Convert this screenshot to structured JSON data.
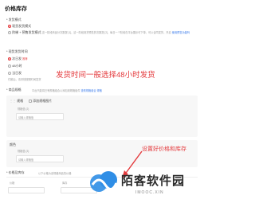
{
  "page": {
    "title": "价格库存"
  },
  "payment": {
    "section_label": "* 发货模式",
    "options": [
      {
        "label": "现货发货模式",
        "checked": true
      },
      {
        "label": "阶梯 + 预售发货模式",
        "checked": false
      }
    ],
    "presale_note": "这一阶段商品分次数提 [1]，这一阶段到货预售的次数提 [2]，每日一个阶段在平台展示可下单，可以合同发货，开启",
    "presale_link": "使用预售功能吗"
  },
  "ship_time": {
    "section_label": "* 现货发货时间",
    "options": [
      {
        "label": "次日发",
        "badge": "推荐",
        "checked": true
      },
      {
        "label": "48小时",
        "checked": false
      },
      {
        "label": "当日发",
        "checked": false
      }
    ],
    "note": "付款后，请尽快按照时间发货"
  },
  "annotation_top": "发货时间一般选择48小时发货",
  "spec": {
    "section_label": "* 商品规格",
    "help_text": "平台只能将已有规格组合以添加到规格组件",
    "help_link": "查看规格组合",
    "help_link2": "规格",
    "spec1": {
      "title": "规格",
      "add_image_label": "添加规格图片",
      "value_label": "规格值 (2)",
      "placeholder": "请输入规格值"
    },
    "spec2": {
      "title": "颜色",
      "value_label": "规格值 (3)",
      "placeholder": "请输入规格值"
    }
  },
  "price": {
    "section_label": "* 价格及库存",
    "note": "以下价格为该规格商品的价格",
    "columns": [
      "价格",
      "库存"
    ]
  },
  "annotation_bottom": "设置好价格和库存",
  "watermark": {
    "text": "陌客软件园",
    "sub": "IMOOC.XIN"
  },
  "colors": {
    "accent": "#e4393c",
    "link": "#3b7bea",
    "logo_blue": "#2f8ee6"
  }
}
